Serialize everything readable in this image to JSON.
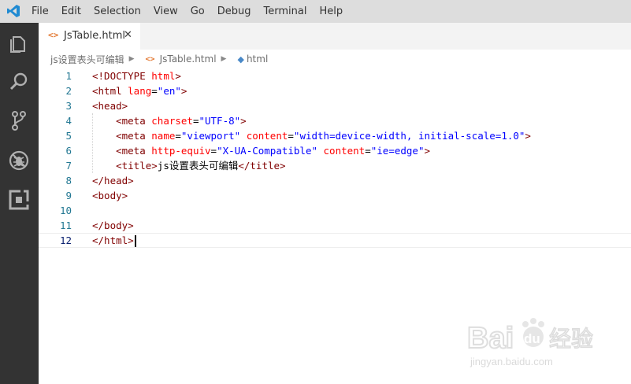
{
  "app": {
    "logo_icon": "vscode-logo-icon",
    "menu": [
      "File",
      "Edit",
      "Selection",
      "View",
      "Go",
      "Debug",
      "Terminal",
      "Help"
    ]
  },
  "activity_bar": [
    "explorer-icon",
    "search-icon",
    "source-control-icon",
    "debug-icon",
    "extensions-icon"
  ],
  "tab": {
    "label": "JsTable.html",
    "icon": "html-file-icon",
    "close": "✕"
  },
  "breadcrumb": {
    "folder": "js设置表头可编辑",
    "file": "JsTable.html",
    "symbol": "html"
  },
  "editor": {
    "active_line": 12,
    "lines": [
      {
        "n": "1",
        "tokens": [
          [
            "t",
            "<!DOCTYPE "
          ],
          [
            "a",
            "html"
          ],
          [
            "t",
            ">"
          ]
        ]
      },
      {
        "n": "2",
        "tokens": [
          [
            "t",
            "<html "
          ],
          [
            "a",
            "lang"
          ],
          [
            "x",
            "="
          ],
          [
            "v",
            "\"en\""
          ],
          [
            "t",
            ">"
          ]
        ]
      },
      {
        "n": "3",
        "tokens": [
          [
            "t",
            "<head>"
          ]
        ]
      },
      {
        "n": "4",
        "tokens": [
          [
            "x",
            "    "
          ],
          [
            "t",
            "<meta "
          ],
          [
            "a",
            "charset"
          ],
          [
            "x",
            "="
          ],
          [
            "v",
            "\"UTF-8\""
          ],
          [
            "t",
            ">"
          ]
        ]
      },
      {
        "n": "5",
        "tokens": [
          [
            "x",
            "    "
          ],
          [
            "t",
            "<meta "
          ],
          [
            "a",
            "name"
          ],
          [
            "x",
            "="
          ],
          [
            "v",
            "\"viewport\""
          ],
          [
            "x",
            " "
          ],
          [
            "a",
            "content"
          ],
          [
            "x",
            "="
          ],
          [
            "v",
            "\"width=device-width, initial-scale=1.0\""
          ],
          [
            "t",
            ">"
          ]
        ]
      },
      {
        "n": "6",
        "tokens": [
          [
            "x",
            "    "
          ],
          [
            "t",
            "<meta "
          ],
          [
            "a",
            "http-equiv"
          ],
          [
            "x",
            "="
          ],
          [
            "v",
            "\"X-UA-Compatible\""
          ],
          [
            "x",
            " "
          ],
          [
            "a",
            "content"
          ],
          [
            "x",
            "="
          ],
          [
            "v",
            "\"ie=edge\""
          ],
          [
            "t",
            ">"
          ]
        ]
      },
      {
        "n": "7",
        "tokens": [
          [
            "x",
            "    "
          ],
          [
            "t",
            "<title>"
          ],
          [
            "x",
            "js设置表头可编辑"
          ],
          [
            "t",
            "</title>"
          ]
        ]
      },
      {
        "n": "8",
        "tokens": [
          [
            "t",
            "</head>"
          ]
        ]
      },
      {
        "n": "9",
        "tokens": [
          [
            "t",
            "<body>"
          ]
        ]
      },
      {
        "n": "10",
        "tokens": []
      },
      {
        "n": "11",
        "tokens": [
          [
            "t",
            "</body>"
          ]
        ]
      },
      {
        "n": "12",
        "tokens": [
          [
            "t",
            "</html>"
          ]
        ]
      }
    ]
  },
  "watermark": {
    "brand": "Bai",
    "brand2": "du",
    "cn": "经验",
    "url": "jingyan.baidu.com"
  }
}
